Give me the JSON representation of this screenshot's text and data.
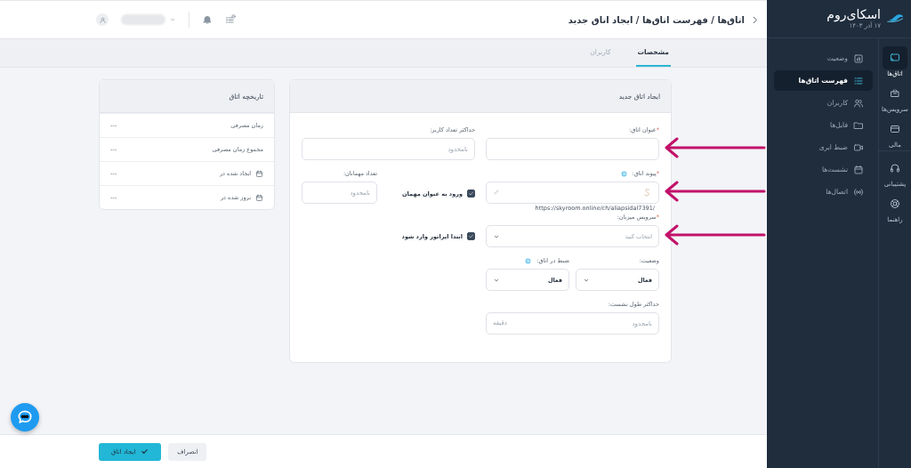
{
  "sidebar": {
    "logo": "اسکای‌روم",
    "date": "۱۷ آذر ۱۴۰۳",
    "rail": [
      [
        {
          "label": "اتاق‌ها",
          "kind": "cast",
          "selected": true
        },
        {
          "label": "سرویس‌ها",
          "kind": "box",
          "selected": false
        },
        {
          "label": "مالی",
          "kind": "card",
          "selected": false
        }
      ],
      [
        {
          "label": "پشتیبانی",
          "kind": "headset",
          "selected": false
        },
        {
          "label": "راهنما",
          "kind": "lifebuoy",
          "selected": false
        }
      ]
    ],
    "menu": [
      {
        "label": "وضعیت",
        "kind": "chart",
        "selected": false
      },
      {
        "label": "فهرست اتاق‌ها",
        "kind": "list",
        "selected": true
      },
      {
        "label": "کاربران",
        "kind": "users",
        "selected": false
      },
      {
        "label": "فایل‌ها",
        "kind": "folder",
        "selected": false
      },
      {
        "label": "ضبط ابری",
        "kind": "video",
        "selected": false
      },
      {
        "label": "نشست‌ها",
        "kind": "calendar",
        "selected": false
      },
      {
        "label": "اتصال‌ها",
        "kind": "signal",
        "selected": false
      }
    ]
  },
  "header": {
    "breadcrumb": "اتاق‌ها / فهرست اتاق‌ها / ایجاد اتاق جدید"
  },
  "tabs": [
    {
      "label": "مشخصات",
      "selected": true
    },
    {
      "label": "کاربران",
      "selected": false
    }
  ],
  "form": {
    "title": "ایجاد اتاق جدید",
    "required_mark": "*",
    "rows": [
      [
        {
          "kind": "text",
          "label": "عنوان اتاق:",
          "required": true,
          "annotated": true
        },
        {
          "kind": "text",
          "label": "حداکثر تعداد کاربر:",
          "placeholder": "نامحدود"
        }
      ],
      [
        {
          "kind": "link",
          "label": "پیوند اتاق:",
          "required": true,
          "info": true,
          "annotated": true,
          "hint": "https://skyroom.online/ch/aliapsidal7391/"
        },
        {
          "kind": "checkbox_field",
          "check": {
            "label": "ورود به عنوان مهمان",
            "checked": true
          },
          "field": {
            "label": "تعداد مهمانان:",
            "placeholder": "نامحدود"
          }
        }
      ],
      [
        {
          "kind": "select",
          "label": "سرویس میزبان:",
          "required": true,
          "annotated": true,
          "placeholder": "انتخاب کنید"
        },
        {
          "kind": "checkbox",
          "label": "ابتدا اپراتور وارد شود",
          "checked": true
        }
      ],
      [
        {
          "kind": "split",
          "items": [
            {
              "kind": "select",
              "label": "وضعیت:",
              "value": "فعال"
            },
            {
              "kind": "select",
              "label": "ضبط در اتاق:",
              "info": true,
              "value": "فعال"
            }
          ]
        }
      ],
      [
        {
          "kind": "text",
          "label": "حداکثر طول نشست:",
          "placeholder": "نامحدود",
          "suffix": "دقیقه"
        }
      ]
    ]
  },
  "history": {
    "title": "تاریخچه اتاق",
    "rows": [
      {
        "label": "زمان مصرفی",
        "value": "---"
      },
      {
        "label": "مجموع زمان مصرفی",
        "value": "---"
      },
      {
        "label": "ایجاد شده در",
        "value": "---",
        "calendar": true
      },
      {
        "label": "بروز شده در",
        "value": "---",
        "calendar": true
      }
    ]
  },
  "footer": {
    "buttons": [
      {
        "label": "انصراف",
        "kind": "secondary"
      },
      {
        "label": "ایجاد اتاق",
        "kind": "primary"
      }
    ]
  }
}
